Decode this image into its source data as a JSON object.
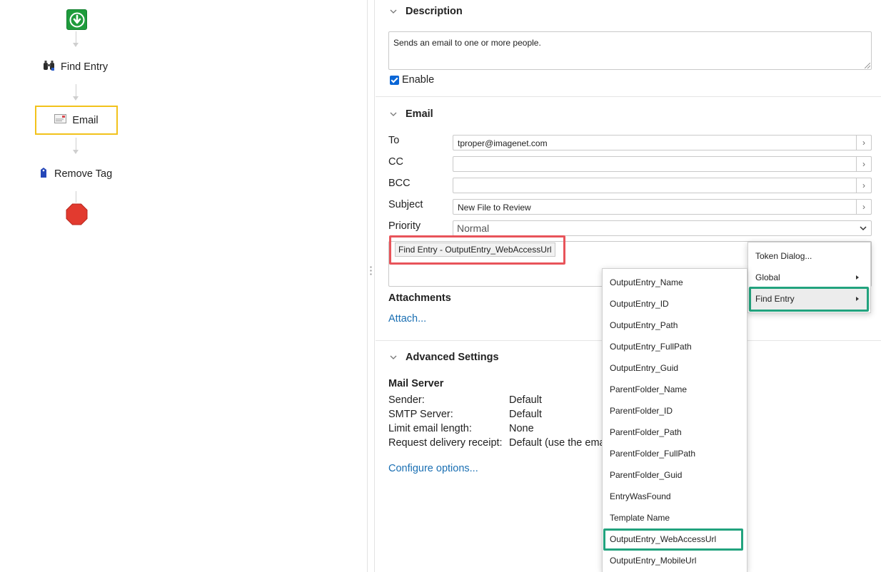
{
  "workflow": {
    "nodes": [
      {
        "id": "find-entry",
        "label": "Find Entry",
        "icon": "binoculars-icon"
      },
      {
        "id": "email",
        "label": "Email",
        "icon": "email-icon",
        "selected": true
      },
      {
        "id": "remove-tag",
        "label": "Remove Tag",
        "icon": "tag-icon"
      }
    ],
    "start_icon": "start-arrow-icon",
    "end_icon": "stop-octagon-icon"
  },
  "description": {
    "header": "Description",
    "text": "Sends an email to one or more people.",
    "enable_label": "Enable",
    "enabled": true
  },
  "email": {
    "header": "Email",
    "to_label": "To",
    "to_value": "tproper@imagenet.com",
    "cc_label": "CC",
    "cc_value": "",
    "bcc_label": "BCC",
    "bcc_value": "",
    "subject_label": "Subject",
    "subject_value": "New File to Review",
    "priority_label": "Priority",
    "priority_value": "Normal",
    "body_token": "Find Entry - OutputEntry_WebAccessUrl",
    "attachments_label": "Attachments",
    "attach_link": "Attach..."
  },
  "advanced": {
    "header": "Advanced Settings",
    "mail_server_title": "Mail Server",
    "rows": [
      {
        "label": "Sender:",
        "value": "Default"
      },
      {
        "label": "SMTP Server:",
        "value": "Default"
      },
      {
        "label": "Limit email length:",
        "value": "None"
      },
      {
        "label": "Request delivery receipt:",
        "value": "Default (use the ema"
      }
    ],
    "configure_link": "Configure options..."
  },
  "token_menu": {
    "items": [
      "Token Dialog...",
      "Global",
      "Find Entry"
    ]
  },
  "find_entry_menu": {
    "items": [
      "OutputEntry_Name",
      "OutputEntry_ID",
      "OutputEntry_Path",
      "OutputEntry_FullPath",
      "OutputEntry_Guid",
      "ParentFolder_Name",
      "ParentFolder_ID",
      "ParentFolder_Path",
      "ParentFolder_FullPath",
      "ParentFolder_Guid",
      "EntryWasFound",
      "Template Name",
      "OutputEntry_WebAccessUrl",
      "OutputEntry_MobileUrl"
    ]
  },
  "colors": {
    "selected_node_border": "#f2c21b",
    "red_highlight": "#e8545a",
    "green_highlight": "#22a37e",
    "link": "#1a6fb3"
  }
}
